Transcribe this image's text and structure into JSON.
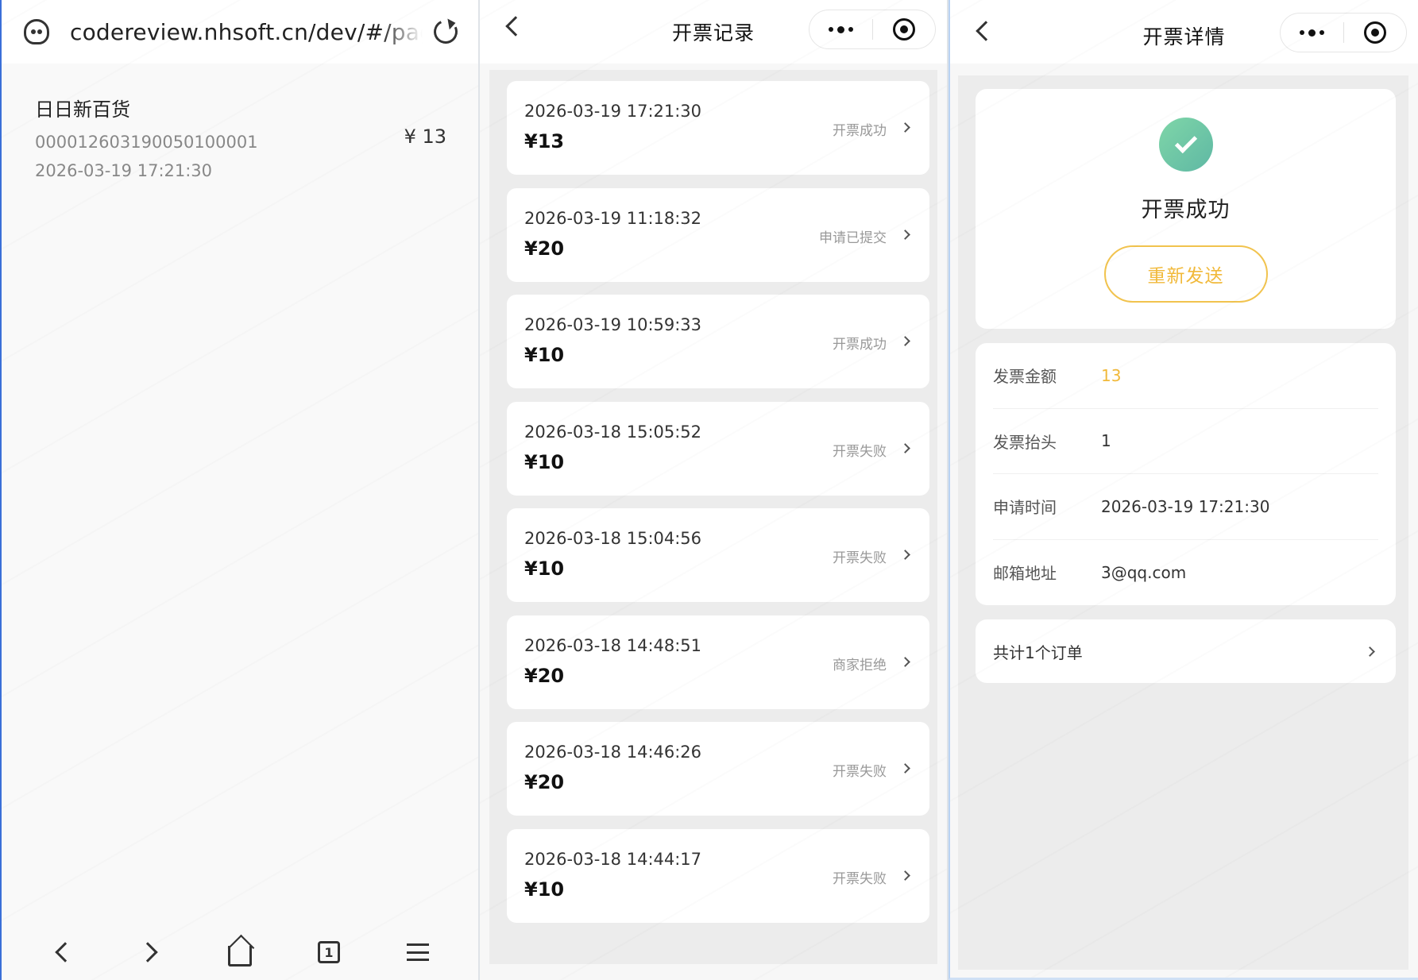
{
  "browser": {
    "url": "codereview.nhsoft.cn/dev/#/pages",
    "order": {
      "store_name": "日日新百货",
      "order_no": "000012603190050100001",
      "time": "2026-03-19 17:21:30",
      "amount": "¥ 13"
    },
    "nav": {
      "tabs_count": "1"
    }
  },
  "records_page": {
    "title": "开票记录",
    "records": [
      {
        "time": "2026-03-19 17:21:30",
        "amount": "¥13",
        "status": "开票成功"
      },
      {
        "time": "2026-03-19 11:18:32",
        "amount": "¥20",
        "status": "申请已提交"
      },
      {
        "time": "2026-03-19 10:59:33",
        "amount": "¥10",
        "status": "开票成功"
      },
      {
        "time": "2026-03-18 15:05:52",
        "amount": "¥10",
        "status": "开票失败"
      },
      {
        "time": "2026-03-18 15:04:56",
        "amount": "¥10",
        "status": "开票失败"
      },
      {
        "time": "2026-03-18 14:48:51",
        "amount": "¥20",
        "status": "商家拒绝"
      },
      {
        "time": "2026-03-18 14:46:26",
        "amount": "¥20",
        "status": "开票失败"
      },
      {
        "time": "2026-03-18 14:44:17",
        "amount": "¥10",
        "status": "开票失败"
      }
    ]
  },
  "detail_page": {
    "title": "开票详情",
    "status_text": "开票成功",
    "resend_label": "重新发送",
    "fields": [
      {
        "label": "发票金额",
        "value": "13"
      },
      {
        "label": "发票抬头",
        "value": "1"
      },
      {
        "label": "申请时间",
        "value": "2026-03-19 17:21:30"
      },
      {
        "label": "邮箱地址",
        "value": "3@qq.com"
      }
    ],
    "orders_summary": "共计1个订单"
  },
  "colors": {
    "accent": "#f1b93a",
    "success": "#6cc6a6",
    "browser_edge": "#3a6fd8"
  },
  "icons": {
    "browser": [
      "ghost-icon",
      "reload-icon",
      "back-icon",
      "forward-icon",
      "home-icon",
      "tabs-icon",
      "menu-icon"
    ],
    "mini_program": [
      "back-icon",
      "more-dots-icon",
      "target-icon",
      "chevron-right-icon",
      "check-icon"
    ]
  }
}
